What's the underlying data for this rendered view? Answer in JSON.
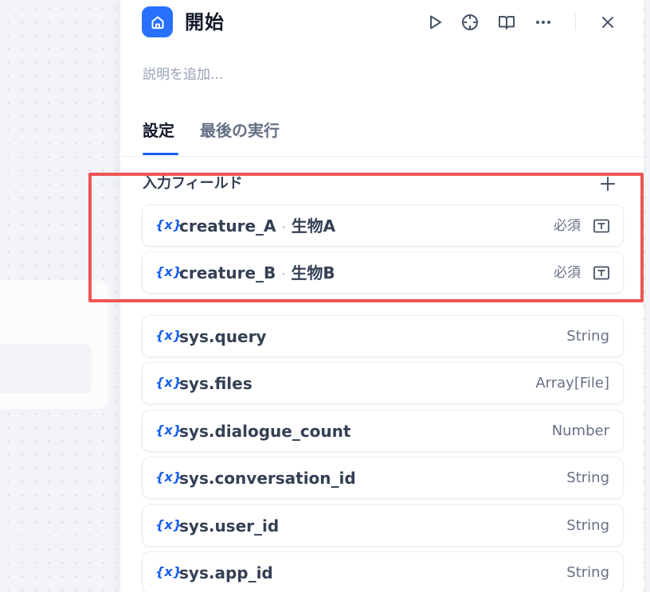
{
  "node": {
    "title": "開始",
    "description_placeholder": "説明を追加..."
  },
  "header_icons": [
    "play-icon",
    "crosshair-icon",
    "book-icon",
    "more-icon",
    "close-icon"
  ],
  "tabs": [
    {
      "label": "設定",
      "active": true
    },
    {
      "label": "最後の実行",
      "active": false
    }
  ],
  "input_fields": {
    "title": "入力フィールド",
    "items": [
      {
        "name": "creature_A",
        "label": "生物A",
        "required_label": "必須",
        "type_icon": "text-input-icon"
      },
      {
        "name": "creature_B",
        "label": "生物B",
        "required_label": "必須",
        "type_icon": "text-input-icon"
      }
    ]
  },
  "system_variables": [
    {
      "name": "sys.query",
      "type": "String"
    },
    {
      "name": "sys.files",
      "type": "Array[File]"
    },
    {
      "name": "sys.dialogue_count",
      "type": "Number"
    },
    {
      "name": "sys.conversation_id",
      "type": "String"
    },
    {
      "name": "sys.user_id",
      "type": "String"
    },
    {
      "name": "sys.app_id",
      "type": "String"
    }
  ],
  "variable_icon_glyph": "{x}",
  "colors": {
    "accent": "#155eef",
    "home_badge": "#2970ff",
    "highlight_border": "#f05454"
  }
}
